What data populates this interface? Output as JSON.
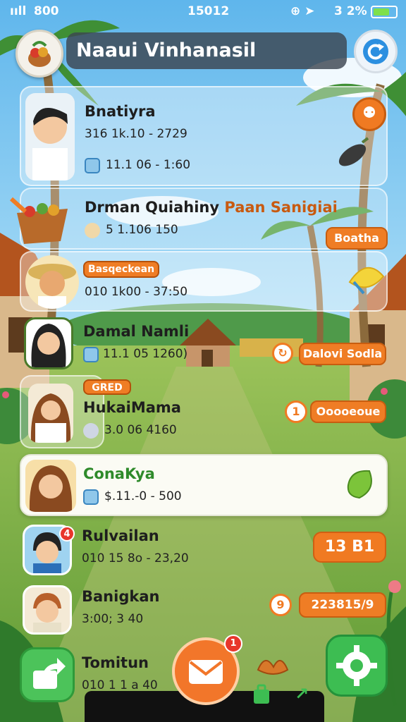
{
  "status_bar": {
    "signal": "ııll",
    "carrier": "800",
    "time": "15012",
    "battery": "3 2%"
  },
  "header": {
    "title": "Naaui Vinhanasil"
  },
  "colors": {
    "accent": "#f07a22",
    "green": "#3dbd52",
    "sky": "#7ec4ee",
    "grass": "#7fb04a"
  },
  "contacts": [
    {
      "name": "Bnatiyra",
      "line1": "316 1k.10 - 2729",
      "line2": "11.1 06 - 1:60"
    },
    {
      "name_dark": "Drman Quiahiny",
      "name_orange": "Paan Sanigiai",
      "line1": "5 1.106 150",
      "action": "Boatha"
    },
    {
      "tag": "Basqeckean",
      "line1": "010 1k00 - 37:50"
    },
    {
      "name": "Damal Namli",
      "line1": "11.1 05 1260)",
      "action": "Dalovi Sodla"
    },
    {
      "tag": "GRED",
      "name": "HukaiMama",
      "line1": "3.0 06 4160",
      "circle": "1",
      "action": "Ooooeoue"
    },
    {
      "name": "ConaKya",
      "line1": "$.11.-0 - 500"
    },
    {
      "name": "Rulvailan",
      "line1": "010 15 8o - 23,20",
      "badge": "4",
      "action": "13 B1"
    },
    {
      "name": "Banigkan",
      "line1": "3:00; 3 40",
      "circle": "9",
      "action": "223815/9"
    },
    {
      "name": "Tomitun",
      "line1": "010 1 1 a 40"
    }
  ],
  "bottom": {
    "mail_badge": "1"
  },
  "icons": [
    "fruit-basket-logo-icon",
    "refresh-icon",
    "share-icon",
    "mail-icon",
    "gear-icon",
    "bag-icon",
    "arrow-icon"
  ]
}
